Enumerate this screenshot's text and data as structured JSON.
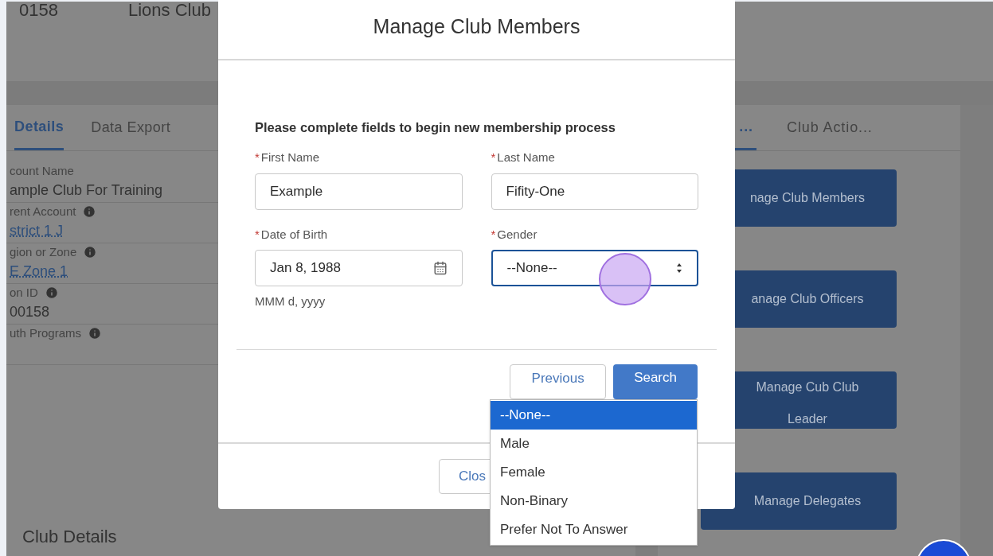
{
  "background_page": {
    "header": {
      "record_id": "0158",
      "club_type": "Lions Club"
    },
    "left_tabs": [
      {
        "label": "Details",
        "selected": true
      },
      {
        "label": "Data Export",
        "selected": false
      }
    ],
    "fields": [
      {
        "label": "count Name",
        "value": "ample Club For Training",
        "kind": "text",
        "info": false
      },
      {
        "label": "rent Account",
        "value": "strict 1 J",
        "kind": "link",
        "info": true
      },
      {
        "label": "gion or Zone",
        "value": "E Zone 1",
        "kind": "link",
        "info": true
      },
      {
        "label": "on ID",
        "value": "00158",
        "kind": "text",
        "info": true
      },
      {
        "label": "uth Programs",
        "kind": "empty",
        "info": true
      }
    ],
    "section_title": "Club Details",
    "right_tabs": [
      {
        "label": "...",
        "selected": true
      },
      {
        "label": "Club Actio...",
        "selected": false
      }
    ],
    "action_buttons": [
      "nage Club Members",
      "anage Club Officers",
      "Manage Cub Club Leader",
      "Manage Delegates"
    ]
  },
  "modal": {
    "title": "Manage Club Members",
    "instructions": "Please complete fields to begin new membership process",
    "fields": [
      {
        "kind": "text",
        "required_mark": "*",
        "label": "First Name",
        "value": "Example"
      },
      {
        "kind": "text",
        "required_mark": "*",
        "label": "Last Name",
        "value": "Fifity-One"
      },
      {
        "kind": "date",
        "required_mark": "*",
        "label": "Date of Birth",
        "value": "Jan 8, 1988",
        "hint": "MMM d, yyyy"
      },
      {
        "kind": "select",
        "required_mark": "*",
        "label": "Gender",
        "value": "--None--",
        "focused": true
      }
    ],
    "buttons": [
      {
        "label": "Previous",
        "kind": "secondary"
      },
      {
        "label": "Search",
        "kind": "primary"
      }
    ],
    "footer_button": "Clos",
    "dropdown": [
      {
        "label": "--None--",
        "selected": true
      },
      {
        "label": "Male",
        "selected": false
      },
      {
        "label": "Female",
        "selected": false
      },
      {
        "label": "Non-Binary",
        "selected": false
      },
      {
        "label": "Prefer Not To Answer",
        "selected": false
      }
    ]
  }
}
